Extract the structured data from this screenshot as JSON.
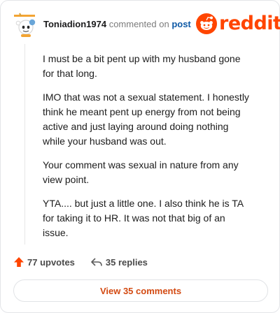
{
  "comment": {
    "username": "Toniadion1974",
    "action_text": "commented on",
    "post_link": "post",
    "paragraphs": [
      "I must be a bit pent up with my husband gone for that long.",
      "IMO that was not a sexual statement. I honestly think he meant pent up energy from not being active and just laying around doing nothing while your husband was out.",
      "Your comment was sexual in nature from any view point.",
      "YTA.... but just a little one. I also think he is TA for taking it to HR. It was not that big of an issue."
    ],
    "upvotes": "77 upvotes",
    "replies": "35 replies"
  },
  "brand": {
    "logo_text": "reddit",
    "color": "#ff4500"
  },
  "footer": {
    "view_comments_label": "View 35 comments"
  },
  "icons": {
    "avatar": "snoo-avatar-icon",
    "logo": "reddit-snoo-icon",
    "upvote": "upvote-arrow-icon",
    "reply": "reply-arrow-icon"
  }
}
